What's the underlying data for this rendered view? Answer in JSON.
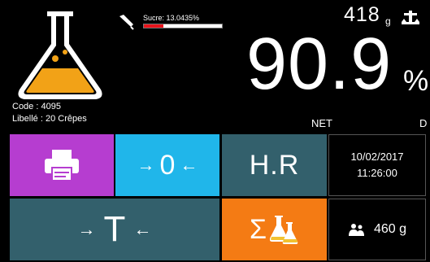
{
  "recipe": {
    "code": "Code : 4095",
    "libelle": "Libellé : 20 Crêpes"
  },
  "sugar": {
    "label": "Sucre: 13.0435%",
    "fill_percent": 25,
    "icon": "pipette-icon"
  },
  "tare": {
    "value": "418",
    "unit": "g",
    "icon": "scale-icon"
  },
  "weight": {
    "value": "90.9",
    "unit": "%",
    "mode": "NET",
    "flag": "D"
  },
  "buttons": {
    "print": {
      "icon": "printer-icon"
    },
    "zero": {
      "left": "→",
      "center": "0",
      "right": "←"
    },
    "hr": {
      "label": "H.R"
    },
    "tare": {
      "left": "→",
      "center": "T",
      "right": "←"
    },
    "sum": {
      "sigma": "Σ",
      "icon": "flasks-icon"
    }
  },
  "info": {
    "date": "10/02/2017",
    "time": "11:26:00",
    "portions": "460 g",
    "portions_icon": "people-icon"
  },
  "colors": {
    "flask": "#f2a217",
    "print": "#b63dd0",
    "zero": "#20b6ea",
    "dark_teal": "#33606c",
    "sum": "#f47b14",
    "sugar_fill": "#e8131b"
  }
}
